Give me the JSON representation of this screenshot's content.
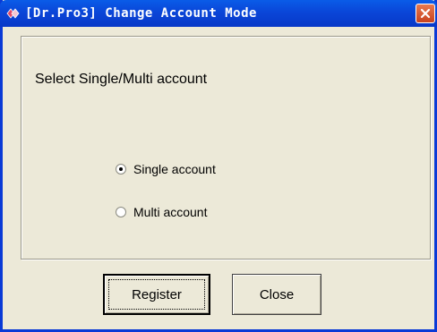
{
  "window": {
    "title": "[Dr.Pro3] Change Account Mode",
    "title_icon": "app-diamond-icon",
    "close_icon": "close-icon"
  },
  "group": {
    "prompt": "Select Single/Multi account",
    "options": [
      {
        "label": "Single account",
        "selected": true
      },
      {
        "label": "Multi account",
        "selected": false
      }
    ]
  },
  "buttons": {
    "register_label": "Register",
    "close_label": "Close"
  },
  "colors": {
    "titlebar": "#0a46d8",
    "window_bg": "#ece9d8",
    "close_button": "#d9532d"
  }
}
